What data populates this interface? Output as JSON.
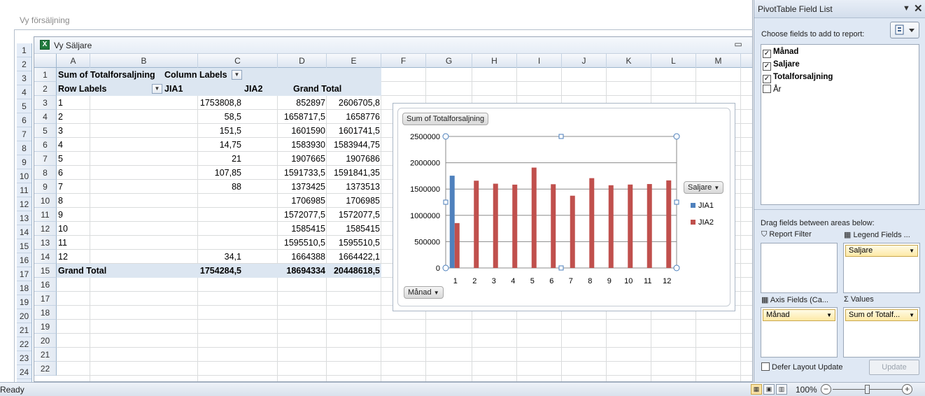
{
  "outer_window": {
    "title": "Vy försäljning"
  },
  "outer_rows": [
    "1",
    "2",
    "3",
    "4",
    "5",
    "6",
    "7",
    "8",
    "9",
    "10",
    "11",
    "12",
    "13",
    "14",
    "15",
    "16",
    "17",
    "18",
    "19",
    "20",
    "21",
    "22",
    "23",
    "24"
  ],
  "inner_window": {
    "title": "Vy Säljare",
    "minimize": "▭"
  },
  "columns": [
    "A",
    "B",
    "C",
    "D",
    "E",
    "F",
    "G",
    "H",
    "I",
    "J",
    "K",
    "L",
    "M"
  ],
  "rows": [
    "1",
    "2",
    "3",
    "4",
    "5",
    "6",
    "7",
    "8",
    "9",
    "10",
    "11",
    "12",
    "13",
    "14",
    "15",
    "16",
    "17",
    "18",
    "19",
    "20",
    "21",
    "22"
  ],
  "pivot": {
    "header_value_field": "Sum of Totalforsaljning",
    "column_labels": "Column Labels",
    "row_labels": "Row Labels",
    "col_names": [
      "JIA1",
      "JIA2",
      "Grand Total"
    ],
    "data_rows": [
      [
        "1",
        "1753808,8",
        "852897",
        "2606705,8"
      ],
      [
        "2",
        "58,5",
        "1658717,5",
        "1658776"
      ],
      [
        "3",
        "151,5",
        "1601590",
        "1601741,5"
      ],
      [
        "4",
        "14,75",
        "1583930",
        "1583944,75"
      ],
      [
        "5",
        "21",
        "1907665",
        "1907686"
      ],
      [
        "6",
        "107,85",
        "1591733,5",
        "1591841,35"
      ],
      [
        "7",
        "88",
        "1373425",
        "1373513"
      ],
      [
        "8",
        "",
        "1706985",
        "1706985"
      ],
      [
        "9",
        "",
        "1572077,5",
        "1572077,5"
      ],
      [
        "10",
        "",
        "1585415",
        "1585415"
      ],
      [
        "11",
        "",
        "1595510,5",
        "1595510,5"
      ],
      [
        "12",
        "34,1",
        "1664388",
        "1664422,1"
      ]
    ],
    "grand_total": [
      "Grand Total",
      "1754284,5",
      "18694334",
      "20448618,5"
    ]
  },
  "chart_data": {
    "type": "bar",
    "title": "",
    "value_field_button": "Sum of Totalforsaljning",
    "axis_button": "Månad",
    "legend_button": "Saljare",
    "categories": [
      "1",
      "2",
      "3",
      "4",
      "5",
      "6",
      "7",
      "8",
      "9",
      "10",
      "11",
      "12"
    ],
    "series": [
      {
        "name": "JIA1",
        "color": "#4f81bd",
        "values": [
          1753808.8,
          58.5,
          151.5,
          14.75,
          21,
          107.85,
          88,
          0,
          0,
          0,
          0,
          34.1
        ]
      },
      {
        "name": "JIA2",
        "color": "#c0504d",
        "values": [
          852897,
          1658717.5,
          1601590,
          1583930,
          1907665,
          1591733.5,
          1373425,
          1706985,
          1572077.5,
          1585415,
          1595510.5,
          1664388
        ]
      }
    ],
    "y_ticks": [
      "0",
      "500000",
      "1000000",
      "1500000",
      "2000000",
      "2500000"
    ],
    "ylim": [
      0,
      2500000
    ],
    "grid": true,
    "legend_position": "right"
  },
  "field_list": {
    "title": "PivotTable Field List",
    "choose_label": "Choose fields to add to report:",
    "fields": [
      {
        "label": "Månad",
        "checked": "✓"
      },
      {
        "label": "Saljare",
        "checked": "✓"
      },
      {
        "label": "Totalforsaljning",
        "checked": "✓"
      },
      {
        "label": "År",
        "checked": ""
      }
    ],
    "drag_label": "Drag fields between areas below:",
    "report_filter": "Report Filter",
    "legend_fields": "Legend Fields ...",
    "legend_item": "Saljare",
    "axis_fields": "Axis Fields (Ca...",
    "axis_item": "Månad",
    "values": "Values",
    "values_item": "Sum of Totalf...",
    "defer_label": "Defer Layout Update",
    "update_button": "Update"
  },
  "status": {
    "ready": "Ready",
    "zoom": "100%"
  }
}
